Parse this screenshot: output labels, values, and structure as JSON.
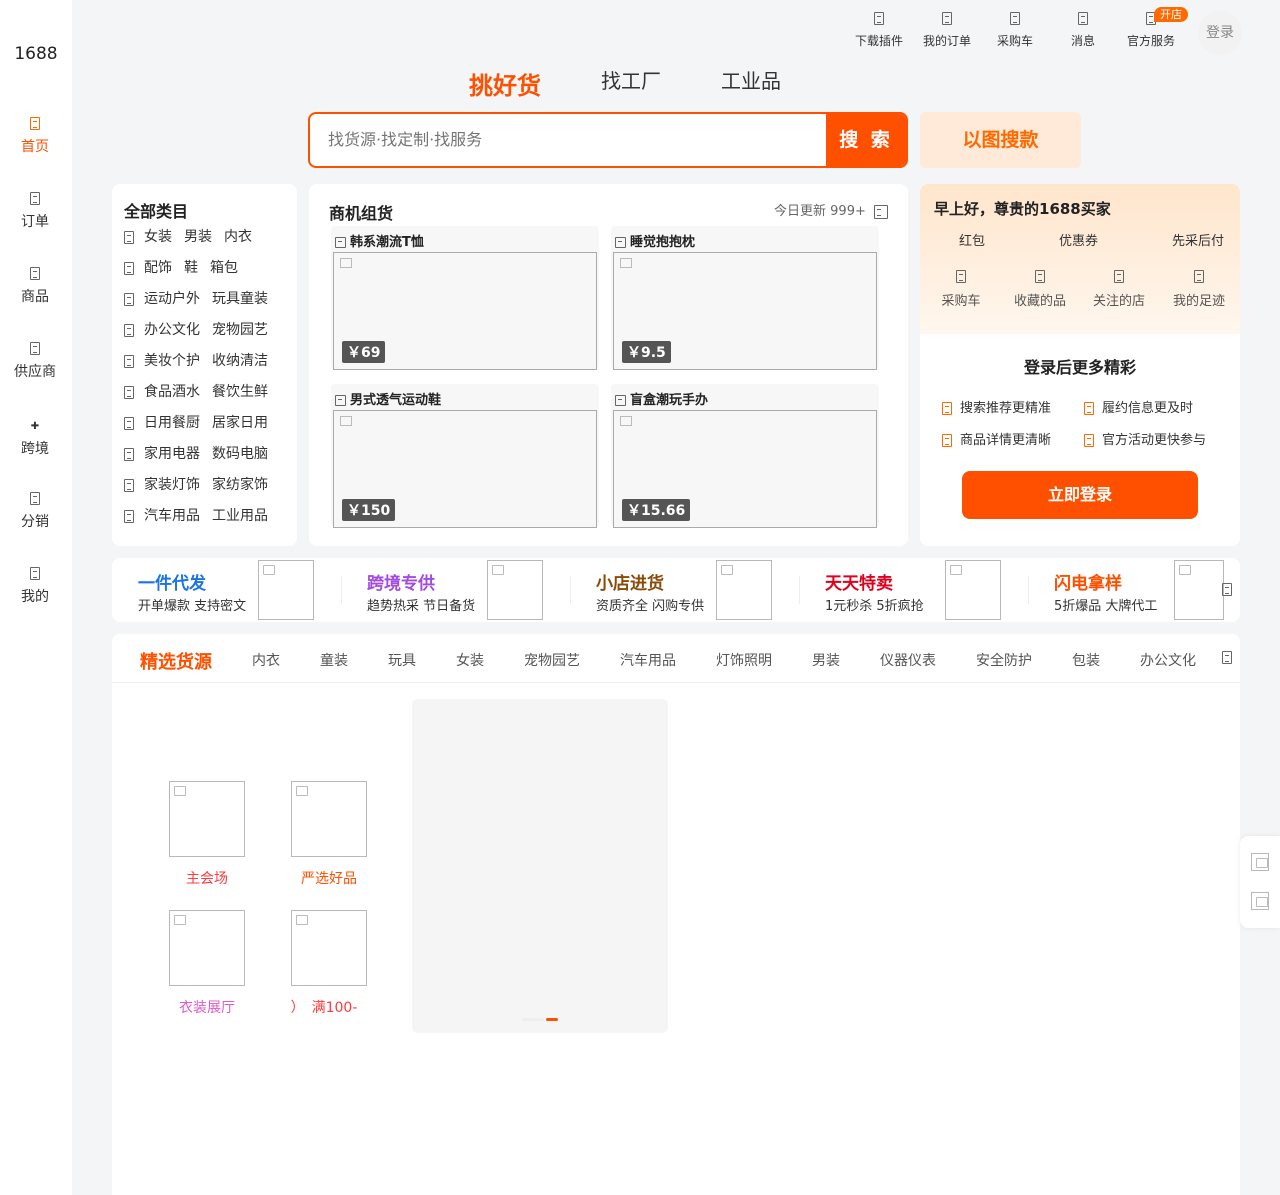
{
  "app": {
    "logo": "1688"
  },
  "sidebar": {
    "items": [
      {
        "label": "首页",
        "icon": "home-icon",
        "active": true
      },
      {
        "label": "订单",
        "icon": "order-icon"
      },
      {
        "label": "商品",
        "icon": "goods-icon"
      },
      {
        "label": "供应商",
        "icon": "supplier-icon"
      },
      {
        "label": "跨境",
        "icon": "cross-border-icon"
      },
      {
        "label": "分销",
        "icon": "distribution-icon"
      },
      {
        "label": "我的",
        "icon": "profile-icon"
      }
    ]
  },
  "topbar": {
    "items": [
      {
        "label": "下载插件",
        "icon": "download-plugin-icon"
      },
      {
        "label": "我的订单",
        "icon": "my-orders-icon"
      },
      {
        "label": "采购车",
        "icon": "purchase-cart-icon"
      },
      {
        "label": "消息",
        "icon": "message-icon"
      },
      {
        "label": "官方服务",
        "icon": "official-service-icon"
      }
    ],
    "open_store_badge": "开店",
    "login": "登录"
  },
  "tabs": [
    {
      "label": "挑好货",
      "active": true
    },
    {
      "label": "找工厂"
    },
    {
      "label": "工业品"
    }
  ],
  "search": {
    "placeholder": "找货源·找定制·找服务",
    "button": "搜 索",
    "image_search": "以图搜款"
  },
  "categories": {
    "title": "全部类目",
    "rows": [
      [
        "女装",
        "男装",
        "内衣"
      ],
      [
        "配饰",
        "鞋",
        "箱包"
      ],
      [
        "运动户外",
        "玩具童装"
      ],
      [
        "办公文化",
        "宠物园艺"
      ],
      [
        "美妆个护",
        "收纳清洁"
      ],
      [
        "食品酒水",
        "餐饮生鲜"
      ],
      [
        "日用餐厨",
        "居家日用"
      ],
      [
        "家用电器",
        "数码电脑"
      ],
      [
        "家装灯饰",
        "家纺家饰"
      ],
      [
        "汽车用品",
        "工业用品"
      ]
    ]
  },
  "business": {
    "title": "商机组货",
    "update": "今日更新 999+",
    "cards": [
      {
        "label": "韩系潮流T恤",
        "price": "￥69"
      },
      {
        "label": "睡觉抱抱枕",
        "price": "￥9.5"
      },
      {
        "label": "男式透气运动鞋",
        "price": "￥150"
      },
      {
        "label": "盲盒潮玩手办",
        "price": "￥15.66"
      }
    ]
  },
  "user": {
    "greeting": "早上好，尊贵的1688买家",
    "perks": [
      "红包",
      "优惠券",
      "先采后付"
    ],
    "shortcuts": [
      "采购车",
      "收藏的品",
      "关注的店",
      "我的足迹"
    ],
    "login_more": "登录后更多精彩",
    "benefits": [
      "搜索推荐更精准",
      "履约信息更及时",
      "商品详情更清晰",
      "官方活动更快参与"
    ],
    "login_button": "立即登录"
  },
  "promos": [
    {
      "title": "一件代发",
      "subtitle": "开单爆款 支持密文",
      "color": "#1a73e8"
    },
    {
      "title": "跨境专供",
      "subtitle": "趋势热采 节日备货",
      "color": "#a24be0"
    },
    {
      "title": "小店进货",
      "subtitle": "资质齐全 闪购专供",
      "color": "#8a4b08"
    },
    {
      "title": "天天特卖",
      "subtitle": "1元秒杀 5折疯抢",
      "color": "#e0001b"
    },
    {
      "title": "闪电拿样",
      "subtitle": "5折爆品 大牌代工",
      "color": "#ff5000"
    }
  ],
  "selected": {
    "title": "精选货源",
    "tabs": [
      "内衣",
      "童装",
      "玩具",
      "女装",
      "宠物园艺",
      "汽车用品",
      "灯饰照明",
      "男装",
      "仪器仪表",
      "安全防护",
      "包装",
      "办公文化"
    ],
    "venues": [
      {
        "label": "主会场",
        "color": "#ff3b3b"
      },
      {
        "label": "严选好品",
        "color": "#ff5000"
      },
      {
        "label": "衣装展厅",
        "color": "#e05ac8"
      },
      {
        "label": "）　满100-",
        "color": "#ff3b3b"
      }
    ]
  }
}
